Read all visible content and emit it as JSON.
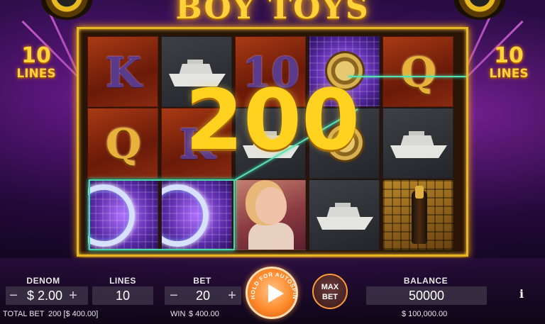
{
  "game": {
    "title": "BOY TOYS",
    "lines_badge": {
      "number": "10",
      "label": "LINES"
    }
  },
  "reels": [
    [
      {
        "symbol": "K",
        "bg": "red"
      },
      {
        "symbol": "Q",
        "bg": "red"
      },
      {
        "symbol": "wheel",
        "bg": "purple"
      }
    ],
    [
      {
        "symbol": "yacht",
        "bg": "dark"
      },
      {
        "symbol": "K",
        "bg": "red"
      },
      {
        "symbol": "wheel",
        "bg": "purple"
      }
    ],
    [
      {
        "symbol": "10",
        "bg": "red"
      },
      {
        "symbol": "yacht",
        "bg": "dark"
      },
      {
        "symbol": "girl",
        "bg": "girl"
      }
    ],
    [
      {
        "symbol": "watch",
        "bg": "purple"
      },
      {
        "symbol": "watch",
        "bg": "dark"
      },
      {
        "symbol": "yacht",
        "bg": "dark"
      }
    ],
    [
      {
        "symbol": "Q",
        "bg": "red"
      },
      {
        "symbol": "yacht",
        "bg": "dark"
      },
      {
        "symbol": "bottle",
        "bg": "gold"
      }
    ]
  ],
  "win_display": "200",
  "controls": {
    "denom": {
      "label": "DENOM",
      "value": "$ 2.00",
      "minus": "−",
      "plus": "+"
    },
    "lines": {
      "label": "LINES",
      "value": "10"
    },
    "bet": {
      "label": "BET",
      "value": "20",
      "minus": "−",
      "plus": "+"
    },
    "spin": {
      "hold_text": "HOLD FOR AUTOSPIN"
    },
    "max_bet": {
      "line1": "MAX",
      "line2": "BET"
    },
    "balance": {
      "label": "BALANCE",
      "value": "50000"
    },
    "info": "i"
  },
  "footer": {
    "total_bet_label": "TOTAL BET",
    "total_bet_value": "200 [$ 400.00]",
    "win_label": "WIN",
    "win_value": "$ 400.00",
    "balance_money": "$ 100,000.00"
  },
  "colors": {
    "gold": "#ffd21f",
    "frame": "#e8b622",
    "payline": "#58e0b0",
    "spin_button": "#ff8a2a"
  }
}
